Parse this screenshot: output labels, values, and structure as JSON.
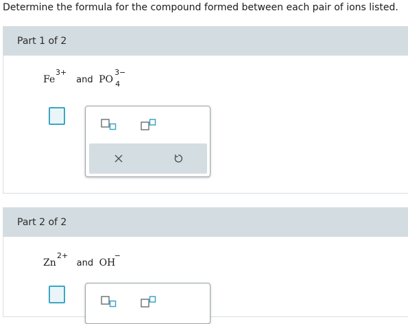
{
  "question": "Determine the formula for the compound formed between each pair of ions listed.",
  "conjunction": "and",
  "parts": [
    {
      "title": "Part 1 of 2",
      "cation": {
        "symbol": "Fe",
        "charge": "3+",
        "subscript": ""
      },
      "anion": {
        "symbol": "PO",
        "charge": "3−",
        "subscript": "4"
      }
    },
    {
      "title": "Part 2 of 2",
      "cation": {
        "symbol": "Zn",
        "charge": "2+",
        "subscript": ""
      },
      "anion": {
        "symbol": "OH",
        "charge": "−",
        "subscript": ""
      }
    }
  ],
  "palette": {
    "icons": [
      "subscript-template-icon",
      "superscript-template-icon",
      "clear-x-icon",
      "undo-icon"
    ]
  },
  "colors": {
    "header_bg": "#d3dde1",
    "accent": "#3aa6c1",
    "border": "#d7dde0"
  }
}
